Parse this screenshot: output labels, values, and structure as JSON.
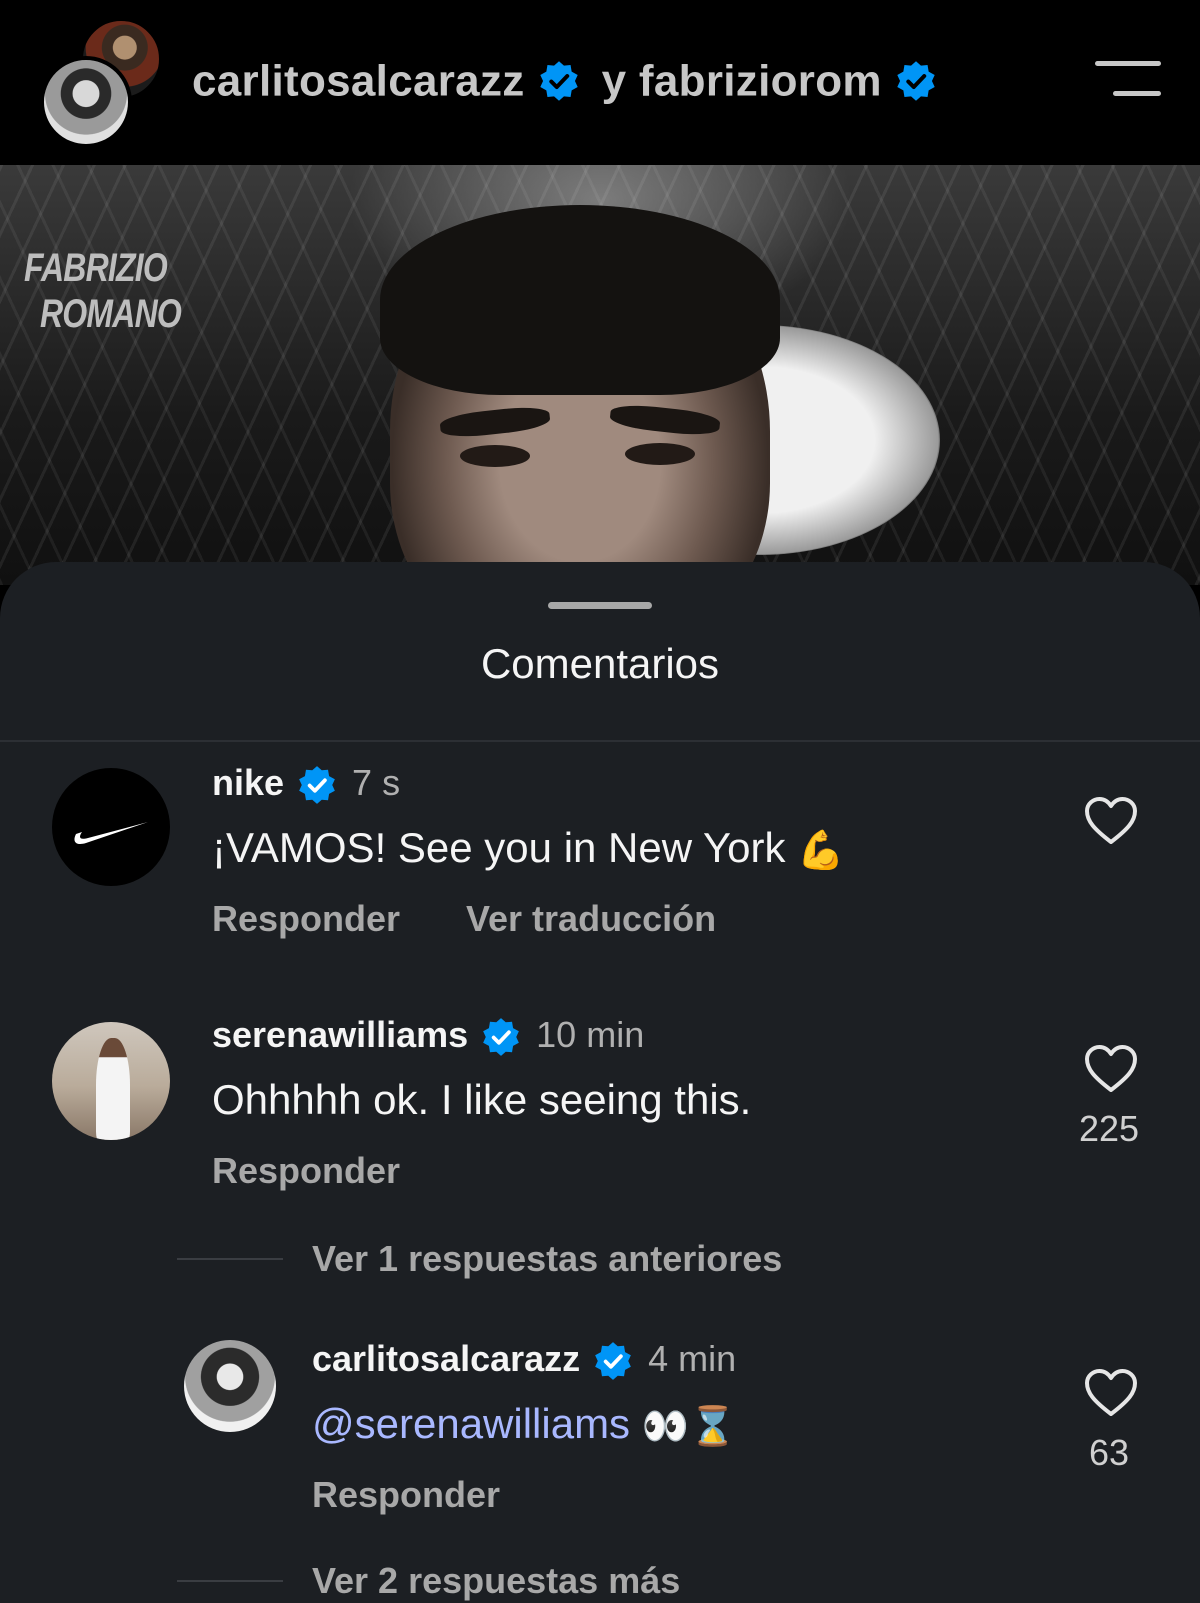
{
  "header": {
    "user1": "carlitosalcarazz",
    "connector": "y",
    "user2": "fabriziorom"
  },
  "photo": {
    "watermark_line1": "FABRIZIO",
    "watermark_line2": "ROMANO"
  },
  "sheet": {
    "title": "Comentarios"
  },
  "comments": [
    {
      "username": "nike",
      "time": "7 s",
      "text": "¡VAMOS! See you in New York",
      "emoji": "💪",
      "reply_label": "Responder",
      "translate_label": "Ver traducción"
    },
    {
      "username": "serenawilliams",
      "time": "10 min",
      "text": "Ohhhhh ok. I like seeing this.",
      "reply_label": "Responder",
      "likes": "225",
      "view_previous": "Ver 1 respuestas anteriores"
    }
  ],
  "reply": {
    "username": "carlitosalcarazz",
    "time": "4 min",
    "mention": "@serenawilliams",
    "emoji": "👀⌛",
    "reply_label": "Responder",
    "likes": "63",
    "view_more": "Ver 2 respuestas más"
  },
  "colors": {
    "sheet_bg": "#1c1f23",
    "verified_blue": "#0095f6",
    "mention": "#a9b8ff"
  }
}
